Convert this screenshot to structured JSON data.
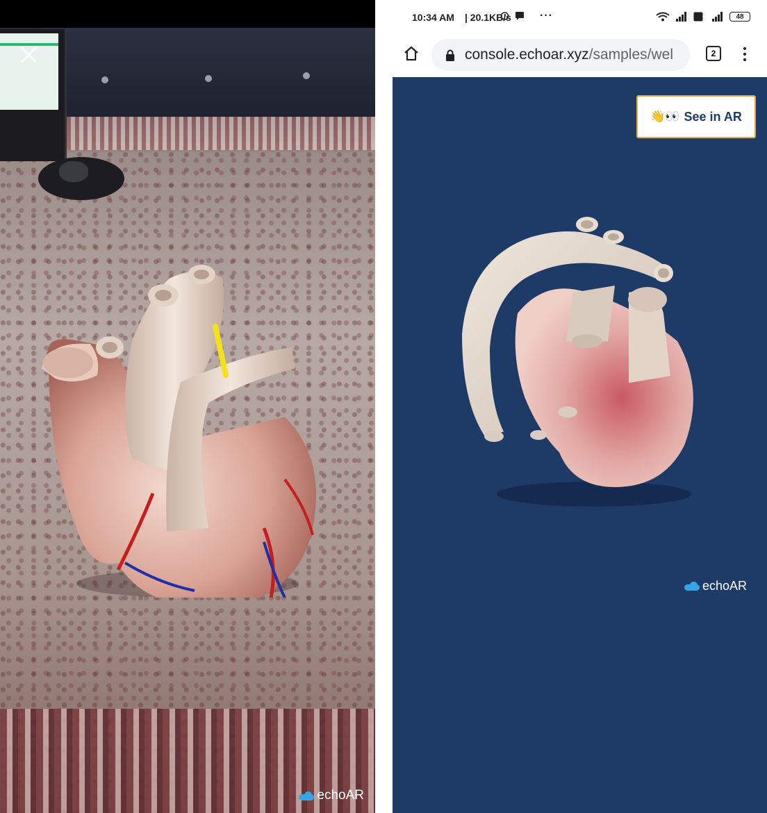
{
  "ar_view": {
    "watermark": "echoAR"
  },
  "status_bar": {
    "time": "10:34 AM",
    "speed": "| 20.1KB/s",
    "more": "···",
    "battery": "48"
  },
  "browser": {
    "url_domain": "console.echoar.xyz",
    "url_path": "/samples/wel",
    "tab_count": "2"
  },
  "viewer": {
    "background_color": "#1e3a66",
    "see_ar_label": "See in AR",
    "see_ar_emoji": "👋👀",
    "watermark": "echoAR"
  },
  "icons": [
    "close-icon",
    "cloud-icon",
    "alarm-icon",
    "message-icon",
    "wifi-icon",
    "signal-icon",
    "battery-icon",
    "home-icon",
    "lock-icon",
    "tabs-icon",
    "menu-icon"
  ]
}
